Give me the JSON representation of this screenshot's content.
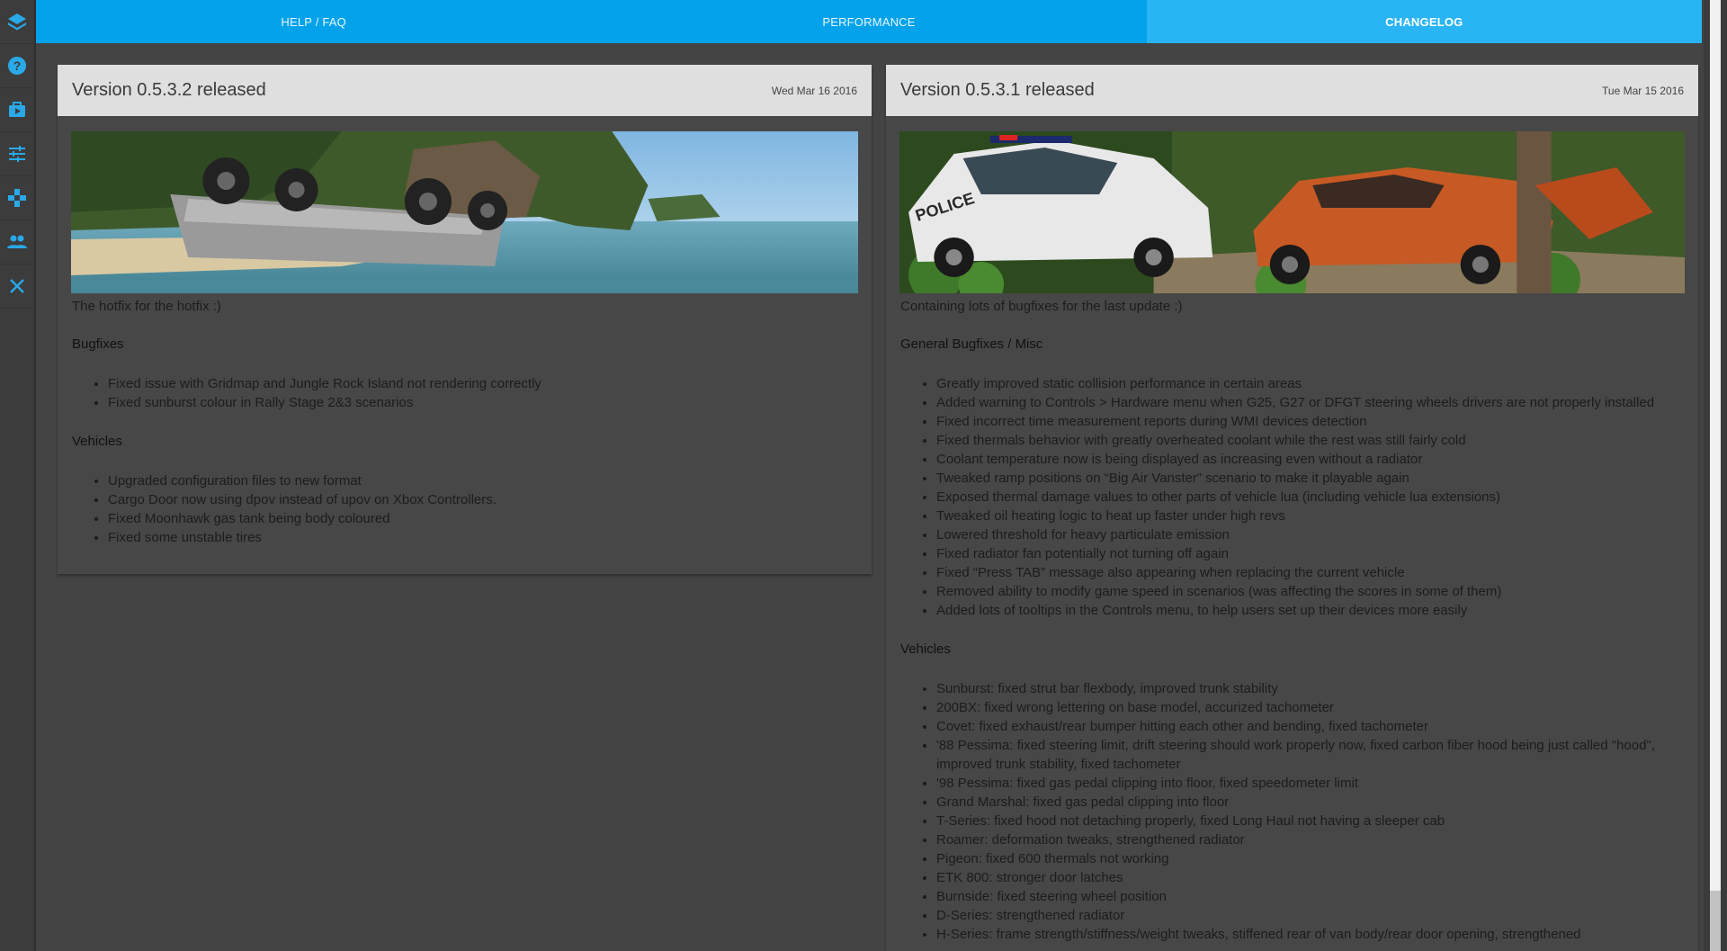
{
  "tabs": [
    {
      "label": "HELP / FAQ",
      "active": false
    },
    {
      "label": "PERFORMANCE",
      "active": false
    },
    {
      "label": "CHANGELOG",
      "active": true
    }
  ],
  "sidebar": {
    "icons": [
      "layers-icon",
      "help-icon",
      "career-icon",
      "options-icon",
      "gamepad-icon",
      "people-icon",
      "close-icon"
    ]
  },
  "colors": {
    "accent": "#03a2ea",
    "active_tab": "#29b4f4",
    "icon": "#29a9e8",
    "card_header": "#dfdfdf",
    "background": "#444444"
  },
  "posts": [
    {
      "title": "Version 0.5.3.2 released",
      "date": "Wed Mar 16 2016",
      "intro": "The hotfix for the hotfix :)",
      "sections": [
        {
          "title": "Bugfixes",
          "items": [
            "Fixed issue with Gridmap and Jungle Rock Island not rendering correctly",
            "Fixed sunburst colour in Rally Stage 2&3 scenarios"
          ]
        },
        {
          "title": "Vehicles",
          "items": [
            "Upgraded configuration files to new format",
            "Cargo Door now using dpov instead of upov on Xbox Controllers.",
            "Fixed Moonhawk gas tank being body coloured",
            "Fixed some unstable tires"
          ]
        }
      ]
    },
    {
      "title": "Version 0.5.3.1 released",
      "date": "Tue Mar 15 2016",
      "intro": "Containing lots of bugfixes for the last update :)",
      "sections": [
        {
          "title": "General Bugfixes / Misc",
          "items": [
            "Greatly improved static collision performance in certain areas",
            "Added warning to Controls > Hardware menu when G25, G27 or DFGT steering wheels drivers are not properly installed",
            "Fixed incorrect time measurement reports during WMI devices detection",
            "Fixed thermals behavior with greatly overheated coolant while the rest was still fairly cold",
            "Coolant temperature now is being displayed as increasing even without a radiator",
            "Tweaked ramp positions on “Big Air Vanster” scenario to make it playable again",
            "Exposed thermal damage values to other parts of vehicle lua (including vehicle lua extensions)",
            "Tweaked oil heating logic to heat up faster under high revs",
            "Lowered threshold for heavy particulate emission",
            "Fixed radiator fan potentially not turning off again",
            "Fixed “Press TAB” message also appearing when replacing the current vehicle",
            "Removed ability to modify game speed in scenarios (was affecting the scores in some of them)",
            "Added lots of tooltips in the Controls menu, to help users set up their devices more easily"
          ]
        },
        {
          "title": "Vehicles",
          "items": [
            "Sunburst: fixed strut bar flexbody, improved trunk stability",
            "200BX: fixed wrong lettering on base model, accurized tachometer",
            "Covet: fixed exhaust/rear bumper hitting each other and bending, fixed tachometer",
            "'88 Pessima: fixed steering limit, drift steering should work properly now, fixed carbon fiber hood being just called \"hood\", improved trunk stability, fixed tachometer",
            "'98 Pessima: fixed gas pedal clipping into floor, fixed speedometer limit",
            "Grand Marshal: fixed gas pedal clipping into floor",
            "T-Series: fixed hood not detaching properly, fixed Long Haul not having a sleeper cab",
            "Roamer: deformation tweaks, strengthened radiator",
            "Pigeon: fixed 600 thermals not working",
            "ETK 800: stronger door latches",
            "Burnside: fixed steering wheel position",
            "D-Series: strengthened radiator",
            "H-Series: frame strength/stiffness/weight tweaks, stiffened rear of van body/rear door opening, strengthened"
          ]
        }
      ]
    }
  ],
  "banner_text": {
    "police": "POLICE"
  }
}
